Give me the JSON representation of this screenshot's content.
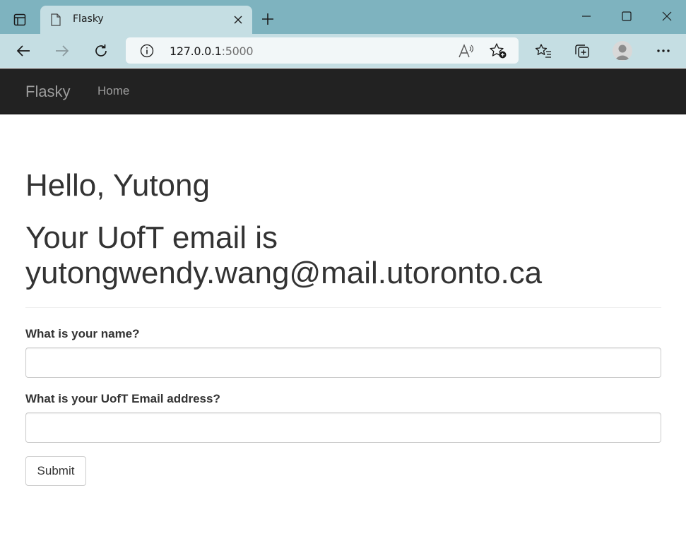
{
  "browser": {
    "tab_title": "Flasky",
    "url_host": "127.0.0.1",
    "url_port": ":5000",
    "icons": {
      "tab_actions": "tab-actions-icon",
      "favicon": "page-icon",
      "tab_close": "close-icon",
      "new_tab": "plus-icon",
      "minimize": "minimize-icon",
      "maximize": "maximize-icon",
      "close_window": "close-icon",
      "back": "back-arrow-icon",
      "forward": "forward-arrow-icon",
      "refresh": "refresh-icon",
      "site_info": "info-icon",
      "read_aloud": "read-aloud-icon",
      "add_favorite": "star-add-icon",
      "favorites": "favorites-icon",
      "collections": "collections-icon",
      "profile": "avatar",
      "more": "more-icon"
    }
  },
  "navbar": {
    "brand": "Flasky",
    "links": [
      "Home"
    ]
  },
  "page": {
    "greeting": "Hello, Yutong",
    "email_line_1": "Your UofT email is",
    "email_line_2": "yutongwendy.wang@mail.utoronto.ca"
  },
  "form": {
    "name_label": "What is your name?",
    "name_value": "",
    "email_label": "What is your UofT Email address?",
    "email_value": "",
    "submit_label": "Submit"
  },
  "colors": {
    "titlebar": "#7eb3bf",
    "toolbar": "#c5dee3",
    "navbar": "#222222",
    "navbar_text": "#9d9d9d",
    "body_text": "#333333"
  }
}
